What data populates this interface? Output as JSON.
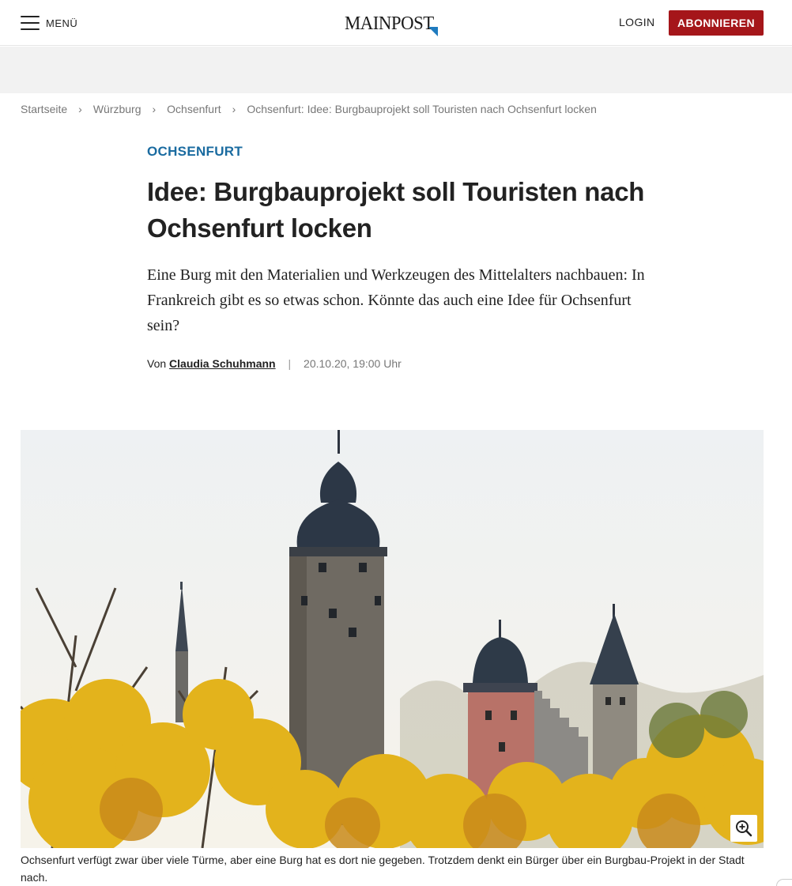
{
  "header": {
    "menu_label": "MENÜ",
    "logo_text": "MAINPOST",
    "login_label": "LOGIN",
    "subscribe_label": "ABONNIEREN",
    "brand_color": "#a5161a",
    "logo_accent_color": "#1f7bbf"
  },
  "breadcrumb": {
    "items": [
      "Startseite",
      "Würzburg",
      "Ochsenfurt",
      "Ochsenfurt: Idee: Burgbauprojekt soll Touristen nach Ochsenfurt locken"
    ],
    "separator_icon": "chevron-right-icon"
  },
  "article": {
    "kicker": "OCHSENFURT",
    "kicker_color": "#1a6ba0",
    "headline": "Idee: Burgbauprojekt soll Touristen nach Ochsenfurt locken",
    "teaser": "Eine Burg mit den Materialien und Werkzeugen des Mittelalters nachbauen: In Frankreich gibt es so etwas schon. Könnte das auch eine Idee für Ochsenfurt sein?",
    "byline_prefix": "Von",
    "author": "Claudia Schuhmann",
    "byline_divider": "|",
    "date": "20.10.20, 19:00 Uhr"
  },
  "hero": {
    "zoom_icon": "zoom-in-icon",
    "caption": "Ochsenfurt verfügt zwar über viele Türme, aber eine Burg hat es dort nie gegeben. Trotzdem denkt ein Bürger über ein Burgbau-Projekt in der Stadt nach."
  }
}
